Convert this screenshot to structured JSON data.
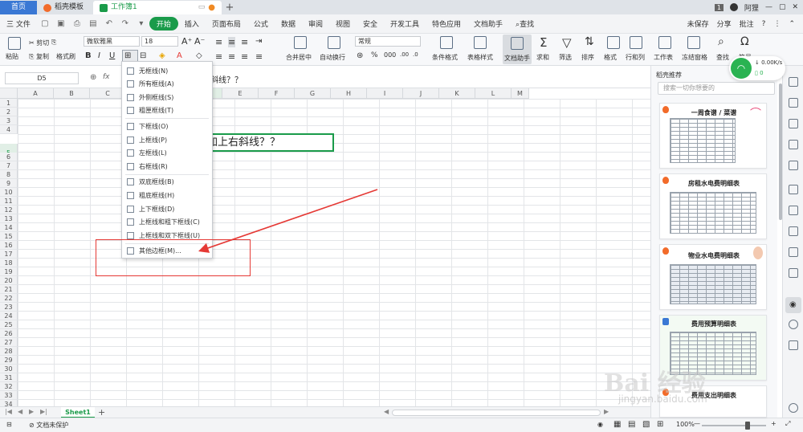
{
  "titlebar": {
    "tabs": [
      "首页",
      "稻壳模板",
      "工作簿1"
    ],
    "badge": "1",
    "user": "阿狸"
  },
  "menu": {
    "file": "三 文件",
    "items": [
      "开始",
      "插入",
      "页面布局",
      "公式",
      "数据",
      "审阅",
      "视图",
      "安全",
      "开发工具",
      "特色应用",
      "文档助手"
    ],
    "search": "查找",
    "right": [
      "未保存",
      "分享",
      "批注"
    ]
  },
  "ribbon": {
    "paste": "粘贴",
    "cut": "剪切",
    "copy": "复制",
    "format_painter": "格式刷",
    "font": "微软雅黑",
    "size": "18",
    "number_format": "常规",
    "merge": "合并居中",
    "wrap": "自动换行",
    "cond_format": "条件格式",
    "table_style": "表格样式",
    "doc_asst": "文档助手",
    "sum": "求和",
    "filter": "筛选",
    "sort": "排序",
    "format": "格式",
    "rowcol": "行和列",
    "sheet": "工作表",
    "freeze": "冻结窗格",
    "find": "查找",
    "symbol": "符号"
  },
  "formula": {
    "cell": "D5",
    "fx": "fx",
    "text": "斜线？？"
  },
  "grid": {
    "columns": [
      "A",
      "B",
      "C",
      "D",
      "E",
      "F",
      "G",
      "H",
      "I",
      "J",
      "K",
      "L",
      "M"
    ],
    "rows": [
      "1",
      "2",
      "3",
      "4",
      "5",
      "6",
      "7",
      "8",
      "9",
      "10",
      "11",
      "12",
      "13",
      "14",
      "15",
      "16",
      "17",
      "18",
      "19",
      "20",
      "21",
      "22",
      "23",
      "24",
      "25",
      "26",
      "27",
      "28",
      "29",
      "30",
      "31",
      "32",
      "33",
      "34",
      "35"
    ],
    "selected_row": "5",
    "selected_col": "D",
    "cell_text": "加上右斜线？？"
  },
  "dropdown": {
    "items": [
      "无框线(N)",
      "所有框线(A)",
      "外侧框线(S)",
      "粗匣框线(T)",
      "下框线(O)",
      "上框线(P)",
      "左框线(L)",
      "右框线(R)",
      "双底框线(B)",
      "粗底框线(H)",
      "上下框线(D)",
      "上框线和粗下框线(C)",
      "上框线和双下框线(U)",
      "其他边框(M)..."
    ]
  },
  "sheets": {
    "tab": "Sheet1",
    "add": "+"
  },
  "status": {
    "protect": "文档未保护",
    "zoom": "100%",
    "zoom_level": 1.0
  },
  "rpanel": {
    "title": "稻壳推荐",
    "search_placeholder": "搜索一切你想要的",
    "cards": [
      "一周食谱 / 菜谱",
      "房租水电费明细表",
      "物业水电费明细表",
      "费用预算明细表",
      "费用支出明细表"
    ]
  },
  "network": {
    "speed": "0.00K/s",
    "up": "0"
  },
  "watermark": {
    "brand": "Bai 经验",
    "url": "jingyan.baidu.com"
  },
  "colors": {
    "accent": "#1a9b4a",
    "home_tab": "#3a78d4",
    "annotation": "#e53935"
  }
}
